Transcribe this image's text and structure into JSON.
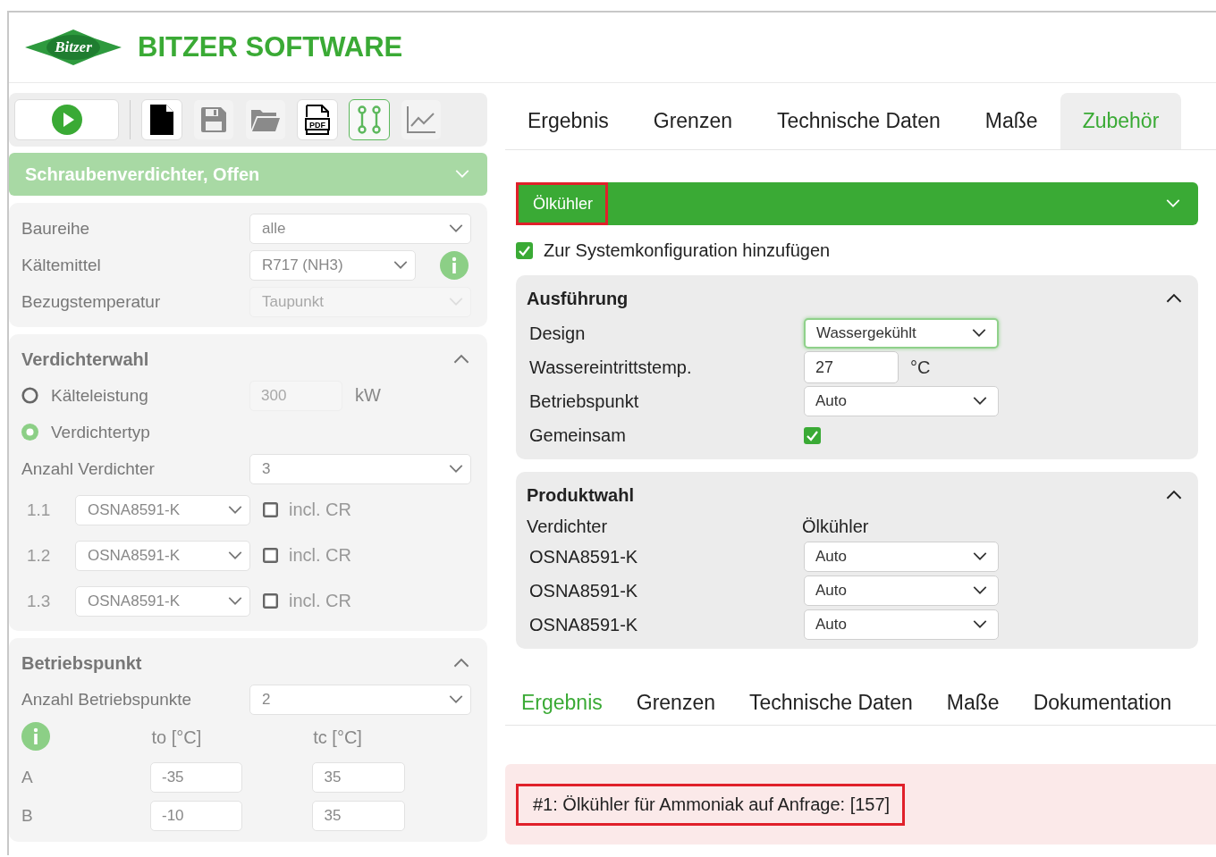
{
  "header": {
    "logo_text": "Bitzer",
    "title": "BITZER SOFTWARE"
  },
  "toolbar": [
    {
      "kind": "run",
      "disabled": false,
      "selected": false
    },
    {
      "kind": "new",
      "disabled": false,
      "selected": false
    },
    {
      "kind": "save",
      "disabled": true,
      "selected": false
    },
    {
      "kind": "open",
      "disabled": true,
      "selected": false
    },
    {
      "kind": "pdf",
      "label": "PDF",
      "disabled": false,
      "selected": false
    },
    {
      "kind": "config",
      "disabled": false,
      "selected": true
    },
    {
      "kind": "chart",
      "disabled": true,
      "selected": false
    }
  ],
  "product_type": {
    "label": "Schraubenverdichter, Offen"
  },
  "basics": [
    {
      "label": "Baureihe",
      "value": "alle",
      "disabled": false,
      "info": false
    },
    {
      "label": "Kältemittel",
      "value": "R717 (NH3)",
      "disabled": false,
      "info": true
    },
    {
      "label": "Bezugstemperatur",
      "value": "Taupunkt",
      "disabled": true,
      "info": false
    }
  ],
  "verdichterwahl": {
    "title": "Verdichterwahl",
    "expanded": true,
    "options": [
      {
        "label": "Kälteleistung",
        "selected": false,
        "value": "300",
        "unit": "kW"
      },
      {
        "label": "Verdichtertyp",
        "selected": true
      }
    ],
    "count_label": "Anzahl Verdichter",
    "count": "3",
    "compressors": [
      {
        "index": "1.1",
        "model": "OSNA8591-K",
        "checked": false,
        "check_label": "incl. CR"
      },
      {
        "index": "1.2",
        "model": "OSNA8591-K",
        "checked": false,
        "check_label": "incl. CR"
      },
      {
        "index": "1.3",
        "model": "OSNA8591-K",
        "checked": false,
        "check_label": "incl. CR"
      }
    ]
  },
  "betriebspunkt": {
    "title": "Betriebspunkt",
    "expanded": true,
    "count_label": "Anzahl Betriebspunkte",
    "count": "2",
    "columns": [
      "to [°C]",
      "tc [°C]"
    ],
    "rows": [
      {
        "label": "A",
        "to": "-35",
        "tc": "35"
      },
      {
        "label": "B",
        "to": "-10",
        "tc": "35"
      }
    ]
  },
  "tabs": [
    {
      "label": "Ergebnis",
      "selected": false
    },
    {
      "label": "Grenzen",
      "selected": false
    },
    {
      "label": "Technische Daten",
      "selected": false
    },
    {
      "label": "Maße",
      "selected": false
    },
    {
      "label": "Zubehör",
      "selected": true
    }
  ],
  "accessory": {
    "title": "Ölkühler",
    "highlighted": true,
    "add_label": "Zur Systemkonfiguration hinzufügen",
    "add_checked": true,
    "ausfuehrung": {
      "title": "Ausführung",
      "expanded": true,
      "rows": [
        {
          "kind": "select",
          "label": "Design",
          "value": "Wassergekühlt",
          "focused": true
        },
        {
          "kind": "input",
          "label": "Wassereintrittstemp.",
          "value": "27",
          "unit": "°C"
        },
        {
          "kind": "select",
          "label": "Betriebspunkt",
          "value": "Auto",
          "focused": false
        },
        {
          "kind": "checkbox",
          "label": "Gemeinsam",
          "checked": true
        }
      ]
    },
    "produktwahl": {
      "title": "Produktwahl",
      "expanded": true,
      "columns": [
        "Verdichter",
        "Ölkühler"
      ],
      "rows": [
        {
          "compressor": "OSNA8591-K",
          "cooler": "Auto"
        },
        {
          "compressor": "OSNA8591-K",
          "cooler": "Auto"
        },
        {
          "compressor": "OSNA8591-K",
          "cooler": "Auto"
        }
      ]
    }
  },
  "result_tabs": [
    {
      "label": "Ergebnis",
      "selected": true
    },
    {
      "label": "Grenzen",
      "selected": false
    },
    {
      "label": "Technische Daten",
      "selected": false
    },
    {
      "label": "Maße",
      "selected": false
    },
    {
      "label": "Dokumentation",
      "selected": false
    }
  ],
  "messages": [
    {
      "text": "#1: Ölkühler für Ammoniak auf Anfrage: [157]",
      "highlighted": true
    }
  ]
}
